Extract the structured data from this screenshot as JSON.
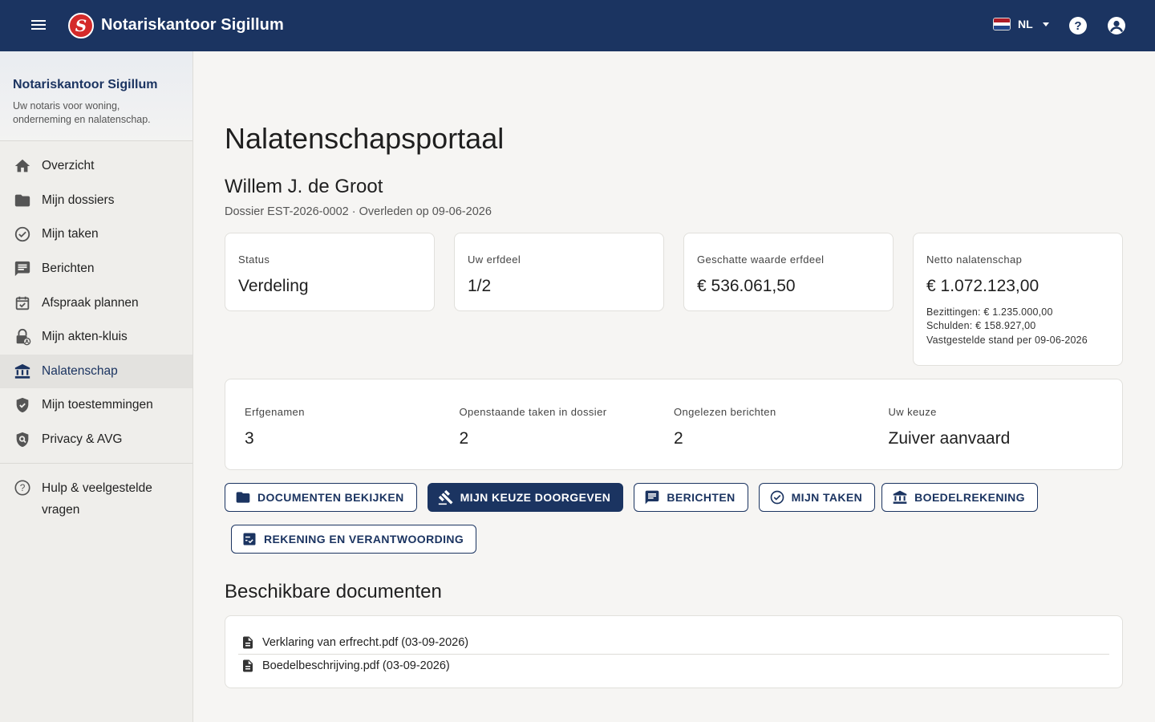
{
  "header": {
    "title": "Notariskantoor Sigillum",
    "logo_letter": "S",
    "language": "NL",
    "colors": {
      "bar": "#1b3461",
      "logo": "#d42a2a"
    }
  },
  "sidebar": {
    "brand_name": "Notariskantoor Sigillum",
    "brand_tagline": "Uw notaris voor woning, onderneming en nalatenschap.",
    "items": [
      {
        "label": "Overzicht",
        "icon": "home-icon"
      },
      {
        "label": "Mijn dossiers",
        "icon": "folder-icon"
      },
      {
        "label": "Mijn taken",
        "icon": "check-circle-icon"
      },
      {
        "label": "Berichten",
        "icon": "message-icon"
      },
      {
        "label": "Afspraak plannen",
        "icon": "calendar-check-icon"
      },
      {
        "label": "Mijn akten-kluis",
        "icon": "lock-icon"
      },
      {
        "label": "Nalatenschap",
        "icon": "bank-icon",
        "active": true
      },
      {
        "label": "Mijn toestemmingen",
        "icon": "shield-check-icon"
      },
      {
        "label": "Privacy & AVG",
        "icon": "shield-search-icon"
      }
    ],
    "help_label": "Hulp & veelgestelde vragen"
  },
  "main": {
    "page_title": "Nalatenschapsportaal",
    "person_name": "Willem J. de Groot",
    "dossier_line": "Dossier EST-2026-0002 · Overleden op 09-06-2026",
    "stats": [
      {
        "label": "Status",
        "value": "Verdeling"
      },
      {
        "label": "Uw erfdeel",
        "value": "1/2"
      },
      {
        "label": "Geschatte waarde erfdeel",
        "value": "€ 536.061,50"
      },
      {
        "label": "Netto nalatenschap",
        "value": "€ 1.072.123,00",
        "sub1": "Bezittingen: € 1.235.000,00",
        "sub2": "Schulden: € 158.927,00",
        "sub3": "Vastgestelde stand per 09-06-2026"
      }
    ],
    "summary": [
      {
        "label": "Erfgenamen",
        "value": "3"
      },
      {
        "label": "Openstaande taken in dossier",
        "value": "2"
      },
      {
        "label": "Ongelezen berichten",
        "value": "2"
      },
      {
        "label": "Uw keuze",
        "value": "Zuiver aanvaard"
      }
    ],
    "actions": [
      {
        "label": "DOCUMENTEN BEKIJKEN",
        "icon": "folder-icon"
      },
      {
        "label": "MIJN KEUZE DOORGEVEN",
        "icon": "gavel-icon",
        "primary": true
      },
      {
        "label": "BERICHTEN",
        "icon": "message-icon"
      },
      {
        "label": "MIJN TAKEN",
        "icon": "check-circle-icon"
      },
      {
        "label": "BOEDELREKENING",
        "icon": "bank-icon"
      },
      {
        "label": "REKENING EN VERANTWOORDING",
        "icon": "checklist-icon"
      }
    ],
    "documents_title": "Beschikbare documenten",
    "documents": [
      "Verklaring van erfrecht.pdf (03-09-2026)",
      "Boedelbeschrijving.pdf (03-09-2026)"
    ]
  }
}
